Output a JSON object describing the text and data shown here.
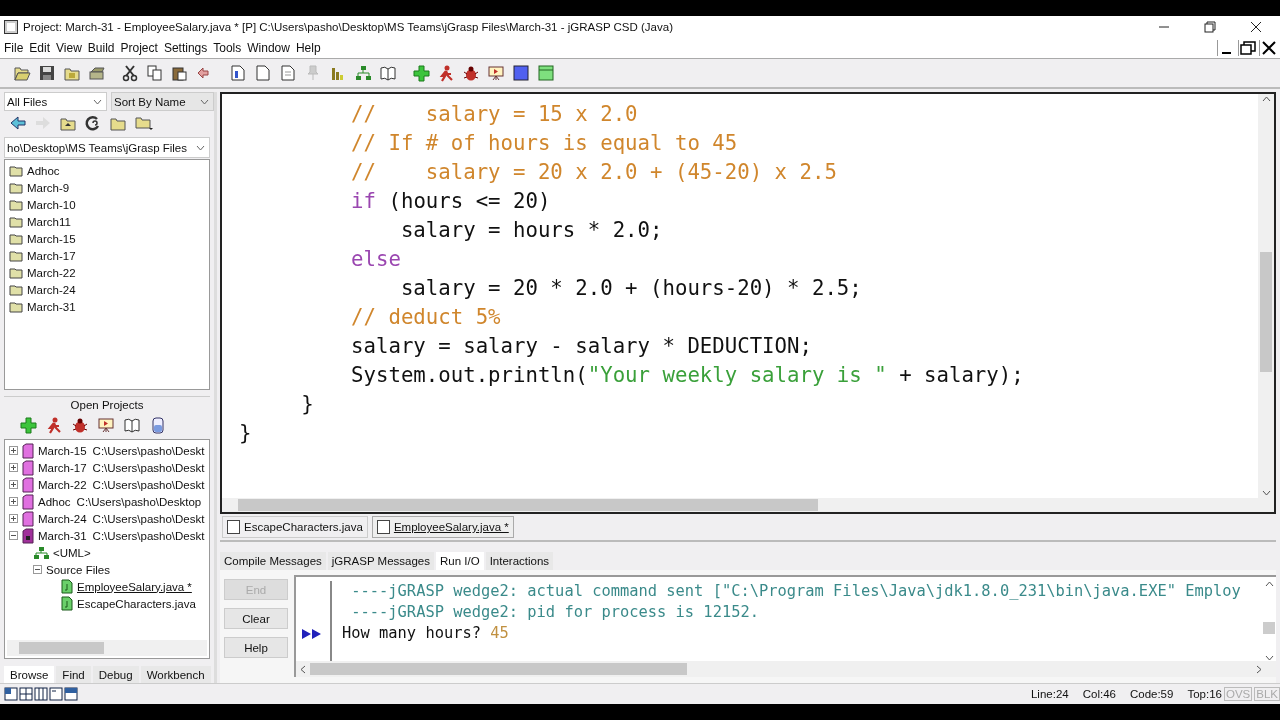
{
  "window": {
    "title": "Project: March-31  - EmployeeSalary.java * [P]  C:\\Users\\pasho\\Desktop\\MS Teams\\jGrasp Files\\March-31 - jGRASP CSD (Java)"
  },
  "menu": [
    "File",
    "Edit",
    "View",
    "Build",
    "Project",
    "Settings",
    "Tools",
    "Window",
    "Help"
  ],
  "browser": {
    "filter": "All Files",
    "sort": "Sort By Name",
    "path": "ho\\Desktop\\MS Teams\\jGrasp Files",
    "folders": [
      {
        "name": "Adhoc"
      },
      {
        "name": "March-9"
      },
      {
        "name": "March-10"
      },
      {
        "name": "March11"
      },
      {
        "name": "March-15"
      },
      {
        "name": "March-17"
      },
      {
        "name": "March-22"
      },
      {
        "name": "March-24"
      },
      {
        "name": "March-31"
      }
    ]
  },
  "open_projects": {
    "title": "Open Projects",
    "items": [
      {
        "name": "March-15",
        "path": "C:\\Users\\pasho\\Deskt",
        "expanded": false
      },
      {
        "name": "March-17",
        "path": "C:\\Users\\pasho\\Deskt",
        "expanded": false
      },
      {
        "name": "March-22",
        "path": "C:\\Users\\pasho\\Deskt",
        "expanded": false
      },
      {
        "name": "Adhoc",
        "path": "C:\\Users\\pasho\\Desktop",
        "expanded": false
      },
      {
        "name": "March-24",
        "path": "C:\\Users\\pasho\\Deskt",
        "expanded": false
      },
      {
        "name": "March-31",
        "path": "C:\\Users\\pasho\\Deskt",
        "expanded": true,
        "children": [
          {
            "kind": "uml",
            "name": "<UML>"
          },
          {
            "kind": "folder",
            "name": "Source Files",
            "expanded": true,
            "children": [
              {
                "kind": "file",
                "name": "EmployeeSalary.java *",
                "selected": true
              },
              {
                "kind": "file",
                "name": "EscapeCharacters.java",
                "selected": false
              }
            ]
          }
        ]
      }
    ]
  },
  "left_tabs": [
    {
      "label": "Browse",
      "selected": true
    },
    {
      "label": "Find",
      "selected": false
    },
    {
      "label": "Debug",
      "selected": false
    },
    {
      "label": "Workbench",
      "selected": false
    }
  ],
  "editor": {
    "lines": [
      [
        {
          "kind": "comment",
          "text": "         //    salary = 15 x 2.0"
        }
      ],
      [
        {
          "kind": "comment",
          "text": "         // If # of hours is equal to 45"
        }
      ],
      [
        {
          "kind": "comment",
          "text": "         //    salary = 20 x 2.0 + (45-20) x 2.5"
        }
      ],
      [
        {
          "kind": "keyword",
          "text": "         if"
        },
        {
          "kind": "plain",
          "text": " (hours <= 20)"
        }
      ],
      [
        {
          "kind": "plain",
          "text": "             salary = hours * 2.0;"
        }
      ],
      [
        {
          "kind": "keyword",
          "text": "         else"
        }
      ],
      [
        {
          "kind": "plain",
          "text": "             salary = 20 * 2.0 + (hours-20) * 2.5;"
        }
      ],
      [
        {
          "kind": "comment",
          "text": "         // deduct 5%"
        }
      ],
      [
        {
          "kind": "plain",
          "text": "         salary = salary - salary * DEDUCTION;"
        }
      ],
      [
        {
          "kind": "plain",
          "text": "         System.out.println("
        },
        {
          "kind": "string",
          "text": "\"Your weekly salary is \""
        },
        {
          "kind": "plain",
          "text": " + salary);"
        }
      ],
      [
        {
          "kind": "plain",
          "text": "     }"
        }
      ],
      [
        {
          "kind": "plain",
          "text": "}"
        }
      ]
    ]
  },
  "file_tabs": [
    {
      "label": "EscapeCharacters.java",
      "selected": false
    },
    {
      "label": "EmployeeSalary.java *",
      "selected": true
    }
  ],
  "message_tabs": [
    {
      "label": "Compile Messages",
      "selected": false
    },
    {
      "label": "jGRASP Messages",
      "selected": false
    },
    {
      "label": "Run I/O",
      "selected": true
    },
    {
      "label": "Interactions",
      "selected": false
    }
  ],
  "io_buttons": [
    {
      "label": "End",
      "disabled": true
    },
    {
      "label": "Clear",
      "disabled": false
    },
    {
      "label": "Help",
      "disabled": false
    }
  ],
  "output": [
    {
      "current": false,
      "tokens": [
        {
          "kind": "system",
          "text": " ----jGRASP wedge2: actual command sent [\"C:\\Program Files\\Java\\jdk1.8.0_231\\bin\\java.EXE\" Employ"
        }
      ]
    },
    {
      "current": false,
      "tokens": [
        {
          "kind": "system",
          "text": " ----jGRASP wedge2: pid for process is 12152."
        }
      ]
    },
    {
      "current": true,
      "tokens": [
        {
          "kind": "plain",
          "text": "How many hours? "
        },
        {
          "kind": "input",
          "text": "45"
        }
      ]
    }
  ],
  "status_bar": {
    "fields": [
      "Line:24",
      "Col:46",
      "Code:59",
      "Top:16"
    ],
    "modes": [
      {
        "label": "OVS",
        "on": false
      },
      {
        "label": "BLK",
        "on": false
      }
    ]
  }
}
